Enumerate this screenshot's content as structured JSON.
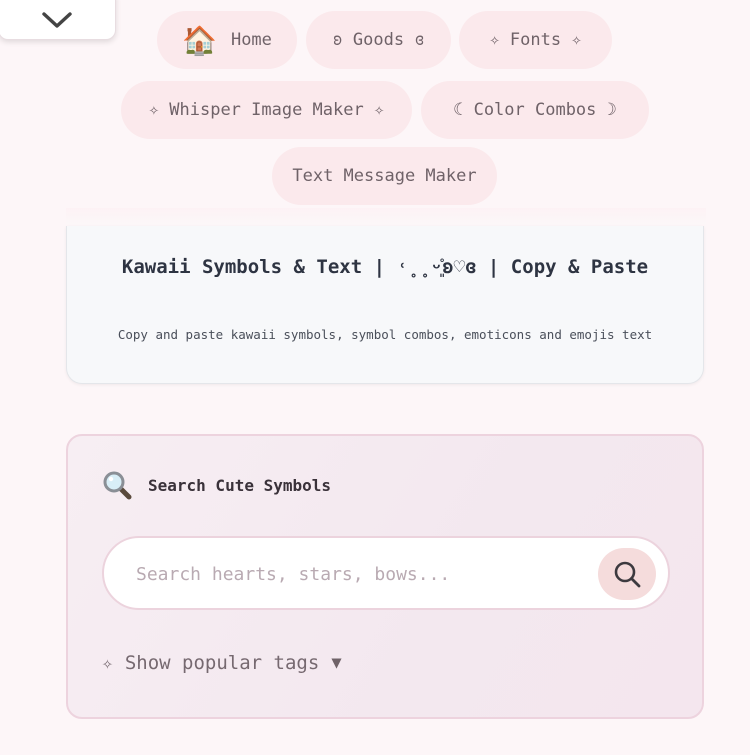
{
  "nav": {
    "home": {
      "emoji": "🏠",
      "label": "Home"
    },
    "goods": "ʚ Goods ɞ",
    "fonts": "✧ Fonts ✧",
    "whisper": "✧ Whisper Image Maker ✧",
    "color_combos": "☾ Color Combos ☽",
    "text_message": "Text Message Maker"
  },
  "info": {
    "title": "Kawaii Symbols & Text | ˓̥̥ᵕ͈̊ʚ♡ɞ | Copy & Paste",
    "subtitle": "Copy and paste kawaii symbols, symbol combos, emoticons and emojis text"
  },
  "search": {
    "heading": "Search Cute Symbols",
    "placeholder": "Search hearts, stars, bows...",
    "value": ""
  },
  "tags": {
    "spark": "✧",
    "label": "Show popular tags",
    "arrow": "▼"
  }
}
